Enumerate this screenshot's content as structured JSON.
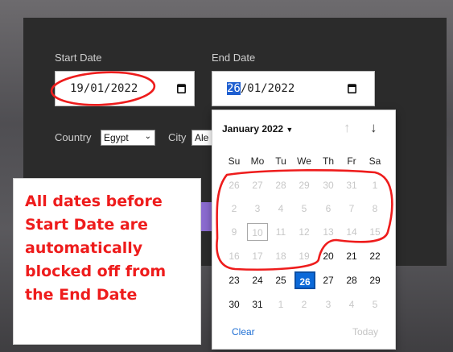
{
  "form": {
    "start_date_label": "Start Date",
    "end_date_label": "End Date",
    "start_date_value": "19/01/2022",
    "end_date_day": "26",
    "end_date_rest": "/01/2022",
    "country_label": "Country",
    "country_value": "Egypt",
    "city_label": "City",
    "city_value": "Ale"
  },
  "datepicker": {
    "month_label": "January 2022",
    "weekdays": [
      "Su",
      "Mo",
      "Tu",
      "We",
      "Th",
      "Fr",
      "Sa"
    ],
    "weeks": [
      [
        "26",
        "27",
        "28",
        "29",
        "30",
        "31",
        "1"
      ],
      [
        "2",
        "3",
        "4",
        "5",
        "6",
        "7",
        "8"
      ],
      [
        "9",
        "10",
        "11",
        "12",
        "13",
        "14",
        "15"
      ],
      [
        "16",
        "17",
        "18",
        "19",
        "20",
        "21",
        "22"
      ],
      [
        "23",
        "24",
        "25",
        "26",
        "27",
        "28",
        "29"
      ],
      [
        "30",
        "31",
        "1",
        "2",
        "3",
        "4",
        "5"
      ]
    ],
    "clear_label": "Clear",
    "today_label": "Today"
  },
  "callout": {
    "lines": [
      "All dates before",
      "Start Date are",
      "automatically",
      "blocked off from",
      "the End Date"
    ]
  },
  "icons": {
    "calendar": "calendar-icon",
    "up": "arrow-up-icon",
    "down": "arrow-down-icon",
    "caret": "caret-down-icon"
  },
  "colors": {
    "panel": "#2b2b2b",
    "selected": "#0b69d9",
    "annotation_red": "#ee1c1c",
    "accent_purple": "#8b6bd0"
  }
}
